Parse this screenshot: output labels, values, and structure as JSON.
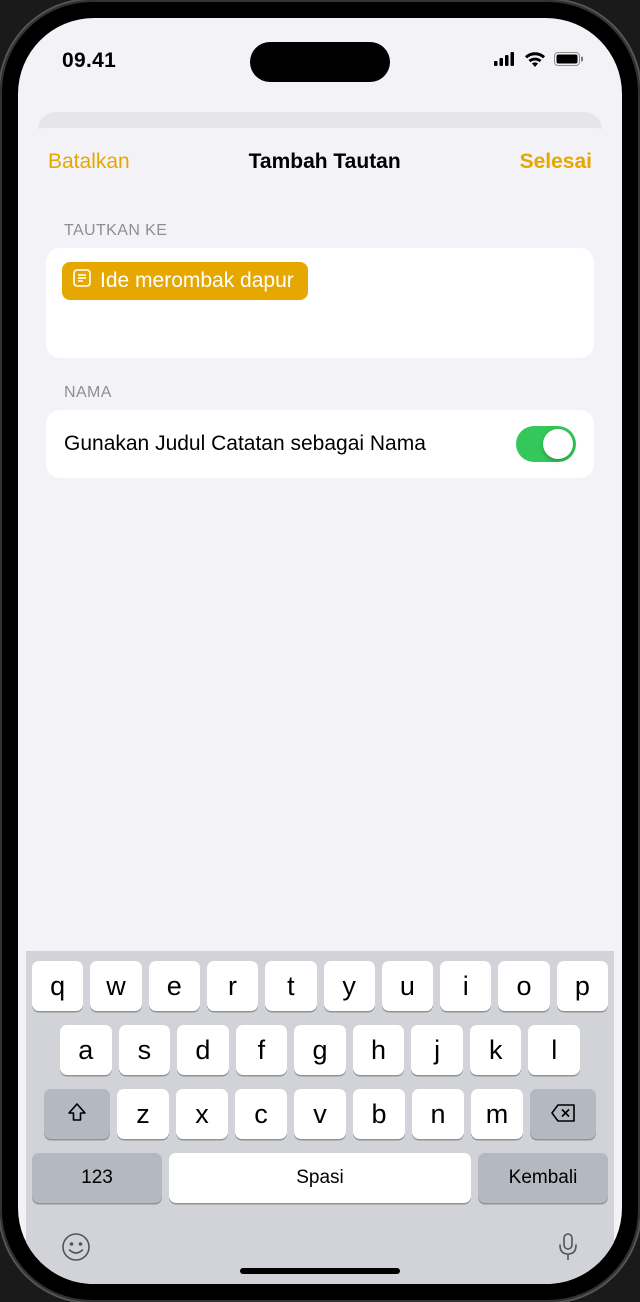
{
  "status": {
    "time": "09.41"
  },
  "nav": {
    "cancel": "Batalkan",
    "title": "Tambah Tautan",
    "done": "Selesai"
  },
  "sections": {
    "link_to": {
      "label": "TAUTKAN KE",
      "chip_text": "Ide merombak dapur"
    },
    "name": {
      "label": "NAMA",
      "toggle_label": "Gunakan Judul Catatan sebagai Nama",
      "toggle_on": true
    }
  },
  "keyboard": {
    "row1": [
      "q",
      "w",
      "e",
      "r",
      "t",
      "y",
      "u",
      "i",
      "o",
      "p"
    ],
    "row2": [
      "a",
      "s",
      "d",
      "f",
      "g",
      "h",
      "j",
      "k",
      "l"
    ],
    "row3": [
      "z",
      "x",
      "c",
      "v",
      "b",
      "n",
      "m"
    ],
    "numbers": "123",
    "space": "Spasi",
    "return": "Kembali"
  }
}
